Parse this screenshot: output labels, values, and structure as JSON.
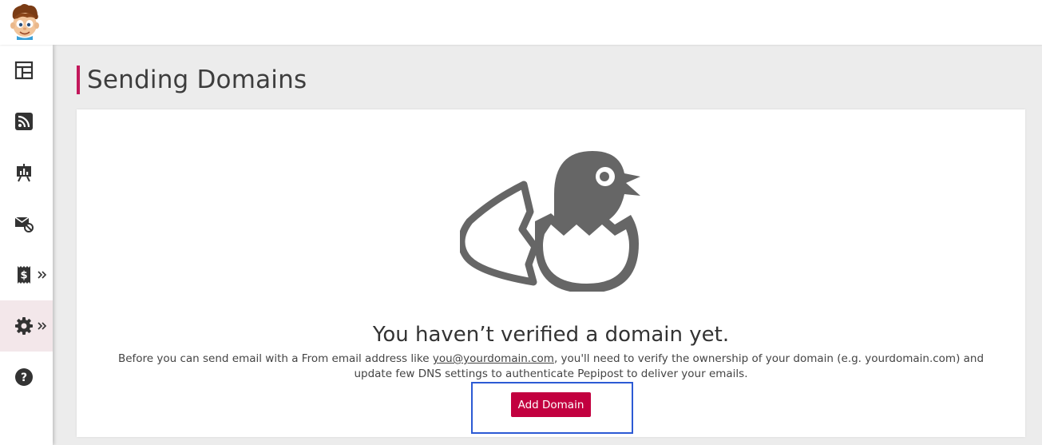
{
  "app": {
    "logo_icon": "cartoon-boy-mascot-logo"
  },
  "sidebar": {
    "items": [
      {
        "icon": "dashboard-icon",
        "has_submenu": false,
        "active": false
      },
      {
        "icon": "rss-feed-icon",
        "has_submenu": false,
        "active": false
      },
      {
        "icon": "reports-easel-icon",
        "has_submenu": false,
        "active": false
      },
      {
        "icon": "email-blocked-icon",
        "has_submenu": false,
        "active": false
      },
      {
        "icon": "billing-receipt-dollar-icon",
        "has_submenu": true,
        "active": false
      },
      {
        "icon": "settings-gear-icon",
        "has_submenu": true,
        "active": true
      },
      {
        "icon": "help-question-icon",
        "has_submenu": false,
        "active": false
      }
    ],
    "submenu_icon": "double-chevron-right-icon"
  },
  "page": {
    "title": "Sending Domains"
  },
  "empty_state": {
    "illustration": "hatching-bird-egg-icon",
    "title": "You haven’t verified a domain yet.",
    "desc_before": "Before you can send email with a From email address like ",
    "desc_link": "you@yourdomain.com",
    "desc_after": ", you'll need to verify the ownership of your domain (e.g. yourdomain.com) and update few DNS settings to authenticate Pepipost to deliver your emails.",
    "button_label": "Add Domain"
  },
  "colors": {
    "accent": "#c2003f",
    "title_bar": "#c2185b",
    "focus_outline": "#2c5ad4",
    "active_nav_bg": "#f3e7ea",
    "illustration": "#666666"
  }
}
